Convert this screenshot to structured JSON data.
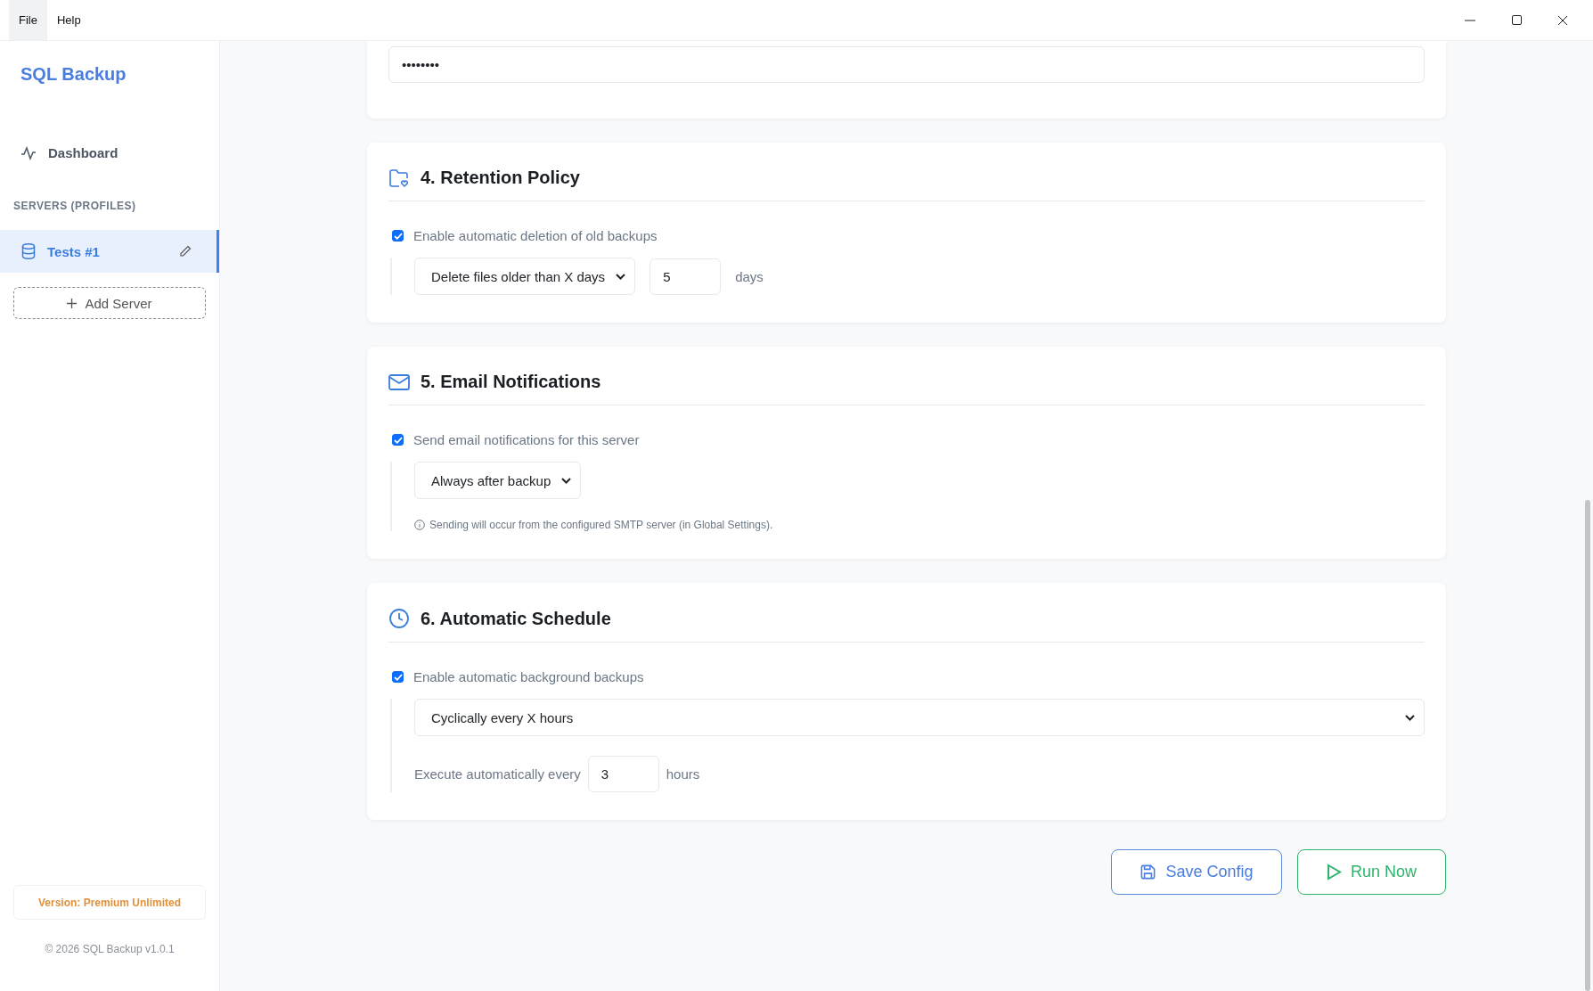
{
  "menu": [
    {
      "label": "File",
      "selected": true
    },
    {
      "label": "Help",
      "selected": false
    }
  ],
  "sidebar": {
    "title": "SQL Backup",
    "nav": [
      {
        "label": "Dashboard",
        "selected": false
      }
    ],
    "section_label": "SERVERS (PROFILES)",
    "servers": [
      {
        "name": "Tests #1",
        "selected": true
      }
    ],
    "add_button": "Add Server",
    "version": "Version: Premium Unlimited",
    "copyright": "© 2026 SQL Backup v1.0.1"
  },
  "sections": [
    {
      "kind": "password",
      "value": "••••••••"
    },
    {
      "kind": "retention",
      "title": "4. Retention Policy",
      "checkbox": {
        "label": "Enable automatic deletion of old backups",
        "checked": true
      },
      "select": "Delete files older than X days",
      "amount": "5",
      "unit": "days"
    },
    {
      "kind": "email",
      "title": "5. Email Notifications",
      "checkbox": {
        "label": "Send email notifications for this server",
        "checked": true
      },
      "select": "Always after backup",
      "note": "Sending will occur from the configured SMTP server (in Global Settings)."
    },
    {
      "kind": "schedule",
      "title": "6. Automatic Schedule",
      "checkbox": {
        "label": "Enable automatic background backups",
        "checked": true
      },
      "select": "Cyclically every X hours",
      "interval_label": "Execute automatically every",
      "amount": "3",
      "unit": "hours"
    }
  ],
  "actions": [
    {
      "kind": "save",
      "label": "Save Config"
    },
    {
      "kind": "run",
      "label": "Run Now"
    }
  ]
}
